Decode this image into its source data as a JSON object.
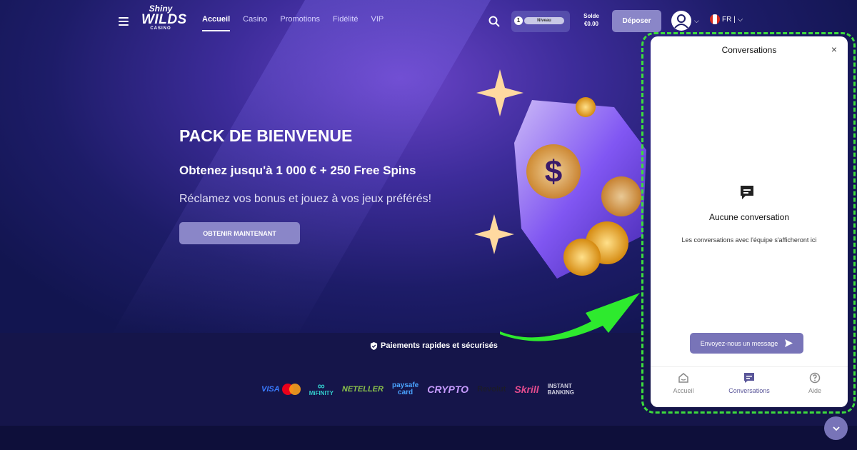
{
  "nav": {
    "menu_items": [
      "Accueil",
      "Casino",
      "Promotions",
      "Fidélité",
      "VIP"
    ],
    "active_item": "Accueil",
    "level_number": "1",
    "level_label": "Niveau",
    "balance_label": "Solde",
    "balance_value": "€0.00",
    "deposit_label": "Déposer",
    "language": "FR |"
  },
  "logo": {
    "line1": "Shiny",
    "line2": "WILDS",
    "line3": "CASINO"
  },
  "hero": {
    "title": "PACK DE BIENVENUE",
    "subtitle": "Obtenez jusqu'à 1 000 € + 250 Free Spins",
    "description": "Réclamez vos bonus et jouez à vos jeux préférés!",
    "cta_label": "OBTENIR MAINTENANT"
  },
  "footer": {
    "secure_text": "Paiements rapides et sécurisés",
    "payment_methods": {
      "visa": "VISA",
      "mifinity": "MiFINITY",
      "neteller": "NETELLER",
      "paysafe_top": "paysafe",
      "paysafe_bottom": "card",
      "crypto": "CRYPTO",
      "revolut": "Revolut",
      "skrill": "Skrill",
      "instant_top": "INSTANT",
      "instant_bottom": "BANKING"
    }
  },
  "chat": {
    "title": "Conversations",
    "empty_title": "Aucune conversation",
    "empty_description": "Les conversations avec l'équipe s'afficheront ici",
    "send_button": "Envoyez-nous un message",
    "tabs": [
      "Accueil",
      "Conversations",
      "Aide"
    ],
    "active_tab": "Conversations"
  },
  "colors": {
    "accent": "#8a86c8",
    "chat_button": "#7874b8",
    "annotation": "#3ddc3d",
    "background": "#1d1c68"
  }
}
